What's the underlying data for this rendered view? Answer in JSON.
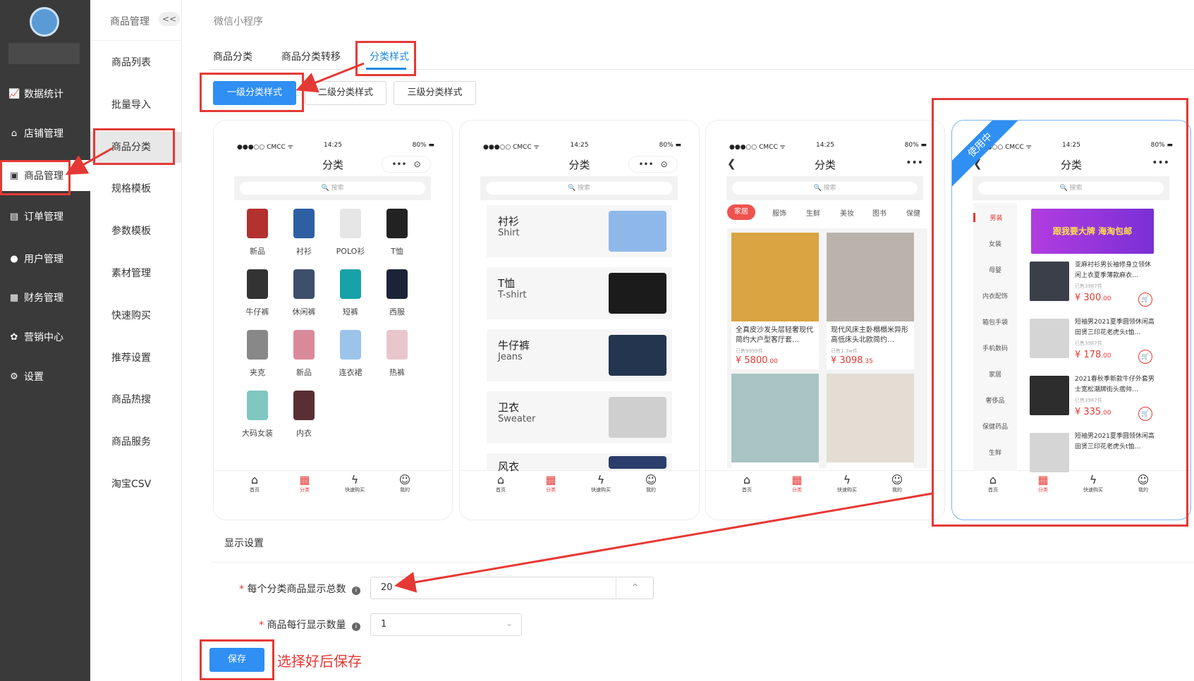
{
  "sidebar": {
    "items": [
      {
        "label": "数据统计",
        "icon": "chart-icon",
        "glyph": "📈"
      },
      {
        "label": "店铺管理",
        "icon": "shop-icon",
        "glyph": "⌂"
      },
      {
        "label": "商品管理",
        "icon": "goods-icon",
        "glyph": "▣"
      },
      {
        "label": "订单管理",
        "icon": "order-icon",
        "glyph": "▤"
      },
      {
        "label": "用户管理",
        "icon": "user-icon",
        "glyph": "●"
      },
      {
        "label": "财务管理",
        "icon": "finance-icon",
        "glyph": "▦"
      },
      {
        "label": "营销中心",
        "icon": "marketing-icon",
        "glyph": "✿"
      },
      {
        "label": "设置",
        "icon": "settings-icon",
        "glyph": "⚙"
      }
    ]
  },
  "submenu": {
    "title": "商品管理",
    "collapse": "<<",
    "items": [
      "商品列表",
      "批量导入",
      "商品分类",
      "规格模板",
      "参数模板",
      "素材管理",
      "快速购买",
      "推荐设置",
      "商品热搜",
      "商品服务",
      "淘宝CSV"
    ]
  },
  "breadcrumb": "微信小程序",
  "tabs": [
    "商品分类",
    "商品分类转移",
    "分类样式"
  ],
  "styles": [
    "一级分类样式",
    "二级分类样式",
    "三级分类样式"
  ],
  "phone": {
    "carrier": "●●●○○ CMCC ᯤ",
    "time": "14:25",
    "battery": "80% ▬",
    "title": "分类",
    "search": "🔍 搜索",
    "more": "•••",
    "back": "❮",
    "tabbar": [
      {
        "label": "首页",
        "icon": "home-icon",
        "glyph": "⌂"
      },
      {
        "label": "分类",
        "icon": "category-icon",
        "glyph": "▦"
      },
      {
        "label": "快速购买",
        "icon": "lightning-icon",
        "glyph": "ϟ"
      },
      {
        "label": "我的",
        "icon": "profile-icon",
        "glyph": "☺"
      }
    ]
  },
  "card1": {
    "items": [
      "新品",
      "衬衫",
      "POLO衫",
      "T恤",
      "牛仔裤",
      "休闲裤",
      "短裤",
      "西服",
      "夹克",
      "新品",
      "连衣裙",
      "热裤",
      "大码女装",
      "内衣"
    ],
    "colors": [
      "#b3312f",
      "#2f5fa3",
      "#e6e6e6",
      "#222222",
      "#333333",
      "#3d4f6b",
      "#16a2a8",
      "#1b2437",
      "#888888",
      "#d98a9a",
      "#9cc4ea",
      "#e8c6cc",
      "#7fc7c0",
      "#5a2e35"
    ]
  },
  "card2": {
    "rows": [
      {
        "cn": "衬衫",
        "en": "Shirt",
        "color": "#8fb8ea"
      },
      {
        "cn": "T恤",
        "en": "T-shirt",
        "color": "#1b1b1b"
      },
      {
        "cn": "牛仔裤",
        "en": "Jeans",
        "color": "#23354f"
      },
      {
        "cn": "卫衣",
        "en": "Sweater",
        "color": "#cfcfcf"
      },
      {
        "cn": "风衣",
        "en": "",
        "color": "#2b3d6b"
      }
    ]
  },
  "card3": {
    "tabs": [
      "家居",
      "服饰",
      "生鲜",
      "美妆",
      "图书",
      "保健"
    ],
    "products": [
      {
        "title": "全真皮沙发头层轻奢现代简约大户型客厅套…",
        "sold": "已售9999件",
        "price": "¥ 5800",
        "dec": ".00",
        "color": "#d9a441"
      },
      {
        "title": "现代风床主卧榻榻米异形高低床头北欧简约…",
        "sold": "已售1.3w件",
        "price": "¥ 3098",
        "dec": ".35",
        "color": "#b9b3ab"
      },
      {
        "title": "",
        "sold": "",
        "price": "",
        "dec": "",
        "color": "#a9c4c4"
      },
      {
        "title": "",
        "sold": "",
        "price": "",
        "dec": "",
        "color": "#e3ddd3"
      }
    ]
  },
  "card4": {
    "ribbon": "使用中",
    "cats": [
      "男装",
      "女装",
      "母婴",
      "内衣配饰",
      "箱包手袋",
      "手机数码",
      "家居",
      "奢侈品",
      "保健药品",
      "生鲜"
    ],
    "banner": "跟我要大牌 海淘包邮",
    "products": [
      {
        "title": "亚麻衬衫男长袖修身立领休闲上衣夏季薄款麻衣…",
        "sold": "已售3987件",
        "price": "¥ 300",
        "dec": ".00",
        "color": "#3a3f4a"
      },
      {
        "title": "短袖男2021夏季圆领休闲高田贤三印花老虎头t恤…",
        "sold": "已售3987件",
        "price": "¥ 178",
        "dec": ".00",
        "color": "#d5d5d5"
      },
      {
        "title": "2021春秋季新款牛仔外套男士宽松潮牌街头痞帅…",
        "sold": "已售3987件",
        "price": "¥ 335",
        "dec": ".00",
        "color": "#2d2d2d"
      },
      {
        "title": "短袖男2021夏季圆领休闲高田贤三印花老虎头t恤…",
        "sold": "",
        "price": "",
        "dec": "",
        "color": "#d5d5d5"
      }
    ],
    "cart": "🛒"
  },
  "settings": {
    "section": "显示设置",
    "total_label": "每个分类商品显示总数",
    "total_value": "20",
    "per_row_label": "商品每行显示数量",
    "per_row_value": "1",
    "required": "*",
    "info": "i",
    "save": "保存",
    "note": "选择好后保存"
  },
  "colors": {
    "accent": "#2f8ff3",
    "annotation": "#e53935",
    "sidebar": "#3a3a3a"
  }
}
